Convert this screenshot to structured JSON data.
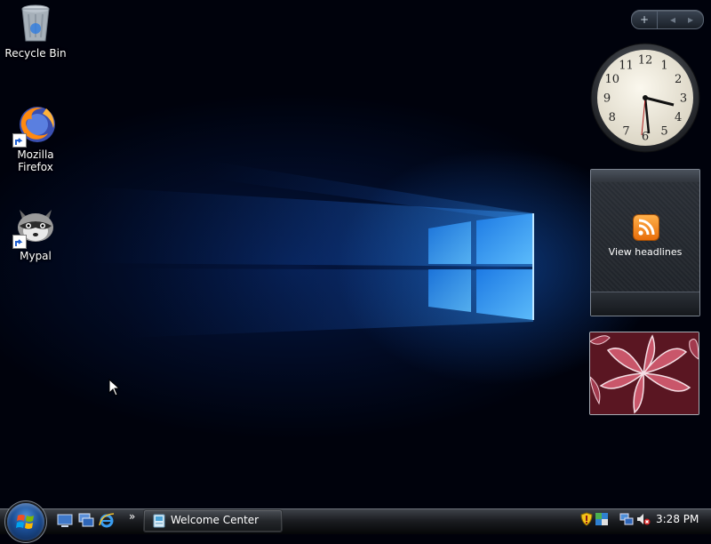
{
  "desktop": {
    "icons": [
      {
        "label": "Recycle Bin",
        "icon": "recycle-bin-icon"
      },
      {
        "label": "Mozilla Firefox",
        "icon": "firefox-icon"
      },
      {
        "label": "Mypal",
        "icon": "mypal-raccoon-icon"
      }
    ]
  },
  "sidebar": {
    "controls": {
      "add": "+",
      "prev": "◂",
      "next": "▸"
    },
    "clock": {
      "numerals": [
        "12",
        "1",
        "2",
        "3",
        "4",
        "5",
        "6",
        "7",
        "8",
        "9",
        "10",
        "11"
      ],
      "time": "3:28"
    },
    "feed": {
      "caption": "View headlines",
      "icon": "rss-icon"
    },
    "slideshow": {
      "icon": "slideshow-photo"
    }
  },
  "taskbar": {
    "start_icon": "windows-logo-icon",
    "quick_launch": [
      "show-desktop-icon",
      "switch-windows-icon",
      "internet-explorer-icon"
    ],
    "overflow": "»",
    "tasks": [
      {
        "label": "Welcome Center",
        "icon": "welcome-center-icon"
      }
    ],
    "tray": [
      "security-shield-icon",
      "network-icon",
      "network-connection-icon",
      "volume-muted-icon"
    ],
    "time": "3:28 PM"
  },
  "colors": {
    "accent": "#1e78ff",
    "feed_orange": "#f28c1e"
  }
}
